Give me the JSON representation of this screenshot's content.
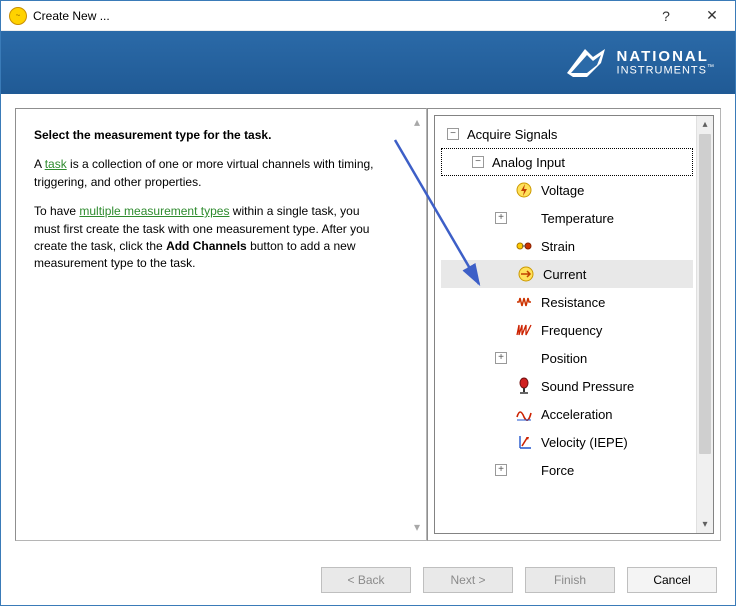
{
  "window": {
    "title": "Create New ...",
    "help_symbol": "?",
    "close_symbol": "✕"
  },
  "brand": {
    "line1": "NATIONAL",
    "line2": "INSTRUMENTS",
    "tm": "™"
  },
  "instructions": {
    "heading": "Select the measurement type for the task.",
    "p1_pre": "A ",
    "p1_link": "task",
    "p1_post": " is a collection of one or more virtual channels with timing, triggering, and other properties.",
    "p2_pre": "To have ",
    "p2_link": "multiple measurement types",
    "p2_mid": " within a single task, you must first create the task with one measurement type. After you create the task, click the ",
    "p2_bold": "Add Channels",
    "p2_post": " button to add a new measurement type to the task."
  },
  "tree": {
    "root": {
      "label": "Acquire Signals",
      "expanded": true
    },
    "group": {
      "label": "Analog Input",
      "expanded": true,
      "focused": true
    },
    "items": [
      {
        "label": "Voltage",
        "icon": "voltage",
        "expandable": false
      },
      {
        "label": "Temperature",
        "icon": "plus",
        "expandable": true
      },
      {
        "label": "Strain",
        "icon": "strain",
        "expandable": false
      },
      {
        "label": "Current",
        "icon": "current",
        "expandable": false,
        "selected": true
      },
      {
        "label": "Resistance",
        "icon": "resistance",
        "expandable": false
      },
      {
        "label": "Frequency",
        "icon": "frequency",
        "expandable": false
      },
      {
        "label": "Position",
        "icon": "plus",
        "expandable": true
      },
      {
        "label": "Sound Pressure",
        "icon": "sound",
        "expandable": false
      },
      {
        "label": "Acceleration",
        "icon": "accel",
        "expandable": false
      },
      {
        "label": "Velocity (IEPE)",
        "icon": "velocity",
        "expandable": false
      },
      {
        "label": "Force",
        "icon": "plus",
        "expandable": true
      }
    ]
  },
  "buttons": {
    "back": {
      "label": "< Back",
      "enabled": false
    },
    "next": {
      "label": "Next >",
      "enabled": false
    },
    "finish": {
      "label": "Finish",
      "enabled": false
    },
    "cancel": {
      "label": "Cancel",
      "enabled": true
    }
  }
}
